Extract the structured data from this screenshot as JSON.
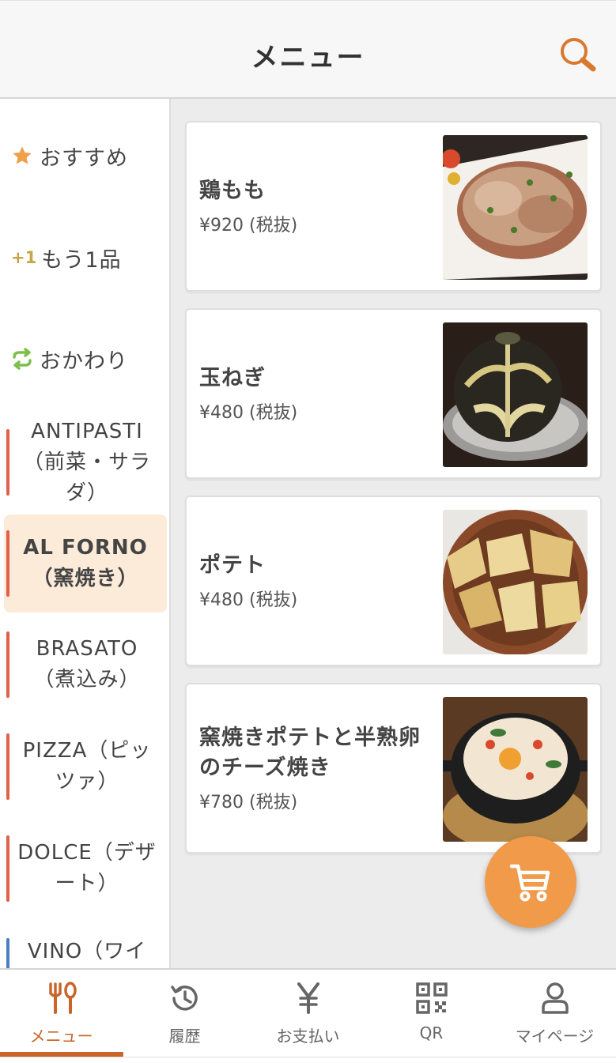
{
  "header": {
    "title": "メニュー",
    "search_icon": "search-icon"
  },
  "sidebar": {
    "specials": [
      {
        "label": "おすすめ",
        "icon": "star-icon",
        "color": "#f0a04b"
      },
      {
        "label": "もう1品",
        "icon_text": "+1",
        "color": "#c8a44a"
      },
      {
        "label": "おかわり",
        "icon": "refresh-icon",
        "color": "#7cbf4a"
      }
    ],
    "categories": [
      {
        "label": "ANTIPASTI（前菜・サラダ）",
        "bar_color": "#e0614a"
      },
      {
        "label": "AL FORNO（窯焼き）",
        "bar_color": "#e0614a",
        "active": true
      },
      {
        "label": "BRASATO（煮込み）",
        "bar_color": "#e0614a"
      },
      {
        "label": "PIZZA（ピッツァ）",
        "bar_color": "#e0614a"
      },
      {
        "label": "DOLCE（デザート）",
        "bar_color": "#e0614a"
      },
      {
        "label": "VINO（ワイ",
        "bar_color": "#4a7fc1"
      }
    ]
  },
  "items": [
    {
      "name": "鶏もも",
      "price": "¥920 (税抜)"
    },
    {
      "name": "玉ねぎ",
      "price": "¥480 (税抜)"
    },
    {
      "name": "ポテト",
      "price": "¥480 (税抜)"
    },
    {
      "name": "窯焼きポテトと半熟卵のチーズ焼き",
      "price": "¥780 (税抜)"
    }
  ],
  "cart": {
    "icon": "cart-icon"
  },
  "nav": [
    {
      "label": "メニュー",
      "icon": "cutlery-icon",
      "active": true
    },
    {
      "label": "履歴",
      "icon": "history-icon"
    },
    {
      "label": "お支払い",
      "icon": "yen-icon"
    },
    {
      "label": "QR",
      "icon": "qr-icon"
    },
    {
      "label": "マイページ",
      "icon": "person-icon"
    }
  ],
  "colors": {
    "accent": "#c9652a",
    "fab": "#f09a4a",
    "active_bg": "#fcebd9"
  }
}
